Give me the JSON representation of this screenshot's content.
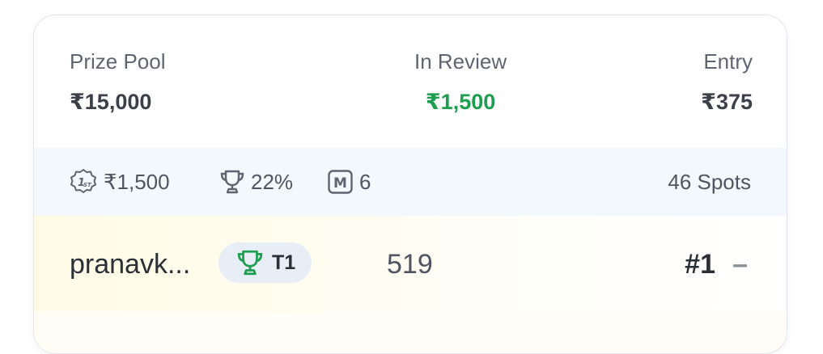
{
  "summary": {
    "prize_pool_label": "Prize Pool",
    "prize_pool_value": "₹15,000",
    "review_label": "In Review",
    "review_value": "₹1,500",
    "entry_label": "Entry",
    "entry_value": "₹375"
  },
  "stats": {
    "first_prize": "₹1,500",
    "first_prize_icon": "first-place-badge-icon",
    "winners_percent": "22%",
    "winners_icon": "trophy-icon",
    "max_teams": "6",
    "max_teams_icon": "multi-entry-icon",
    "max_teams_glyph": "M",
    "spots": "46 Spots"
  },
  "leaderboard": {
    "rows": [
      {
        "username": "pranavk...",
        "team": "T1",
        "team_icon": "trophy-icon",
        "points": "519",
        "rank": "#1",
        "rank_change": "–"
      }
    ]
  },
  "colors": {
    "review_green": "#1e9e50",
    "trophy_green": "#1e9e50",
    "stats_background": "#f3f8fd",
    "row_highlight": "#fffbe6",
    "badge_background": "#e8eef5"
  }
}
